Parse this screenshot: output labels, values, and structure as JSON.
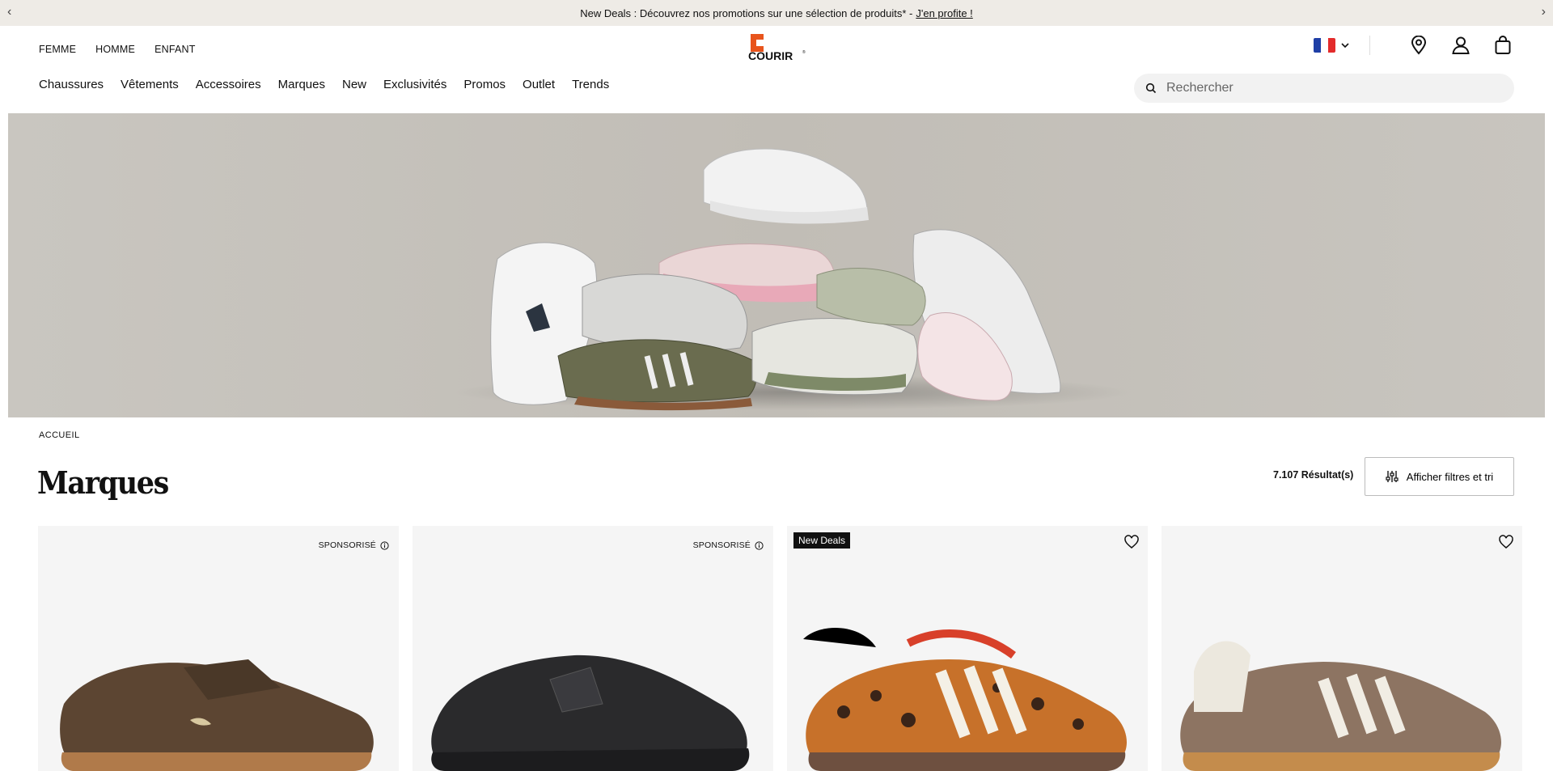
{
  "promo": {
    "text": "New Deals : Découvrez nos promotions sur une sélection de produits* -",
    "link": "J'en profite !"
  },
  "gender_nav": [
    "FEMME",
    "HOMME",
    "ENFANT"
  ],
  "logo": {
    "text": "COURIR"
  },
  "main_nav": [
    "Chaussures",
    "Vêtements",
    "Accessoires",
    "Marques",
    "New",
    "Exclusivités",
    "Promos",
    "Outlet",
    "Trends"
  ],
  "search": {
    "placeholder": "Rechercher"
  },
  "header_icons": [
    "flag-fr-icon",
    "chevron-down-icon",
    "store-locator-icon",
    "account-icon",
    "cart-icon"
  ],
  "breadcrumb": "ACCUEIL",
  "page_title": "Marques",
  "results": "7.107 Résultat(s)",
  "filters_button": "Afficher filtres et tri",
  "products": [
    {
      "label": "SPONSORISÉ",
      "kind": "sponsored"
    },
    {
      "label": "SPONSORISÉ",
      "kind": "sponsored"
    },
    {
      "label": "New Deals",
      "kind": "badge"
    },
    {
      "label": "",
      "kind": "wishlist"
    }
  ],
  "colors": {
    "promo_bg": "#eeebe6",
    "logo_orange": "#e8541c",
    "card_bg": "#f5f5f5"
  }
}
